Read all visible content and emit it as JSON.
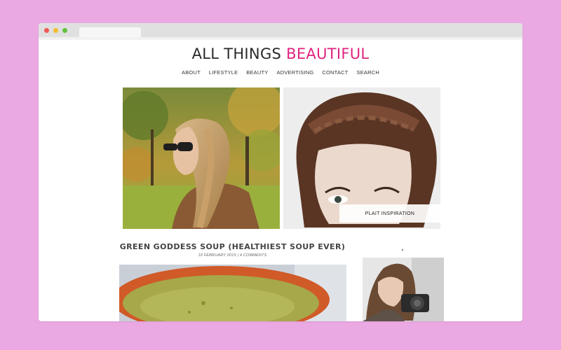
{
  "site": {
    "title_main": "ALL THINGS ",
    "title_accent": "BEAUTIFUL",
    "accent_color": "#e0237f"
  },
  "nav": {
    "items": [
      "ABOUT",
      "LIFESTYLE",
      "BEAUTY",
      "ADVERTISING",
      "CONTACT",
      "SEARCH"
    ]
  },
  "hero": {
    "left_image": "woman-braid-sunglasses-photo",
    "right_image": "woman-crown-braid-photo",
    "caption": "PLAIT INSPIRATION"
  },
  "post": {
    "title": "GREEN GODDESS SOUP (HEALTHIEST SOUP EVER)",
    "meta": "10 FEBRUARY 2015  |  4 COMMENTS",
    "image": "green-soup-bowl-photo"
  },
  "sidebar": {
    "image": "woman-camera-photo"
  },
  "colors": {
    "background": "#eba9e3",
    "window": "#ffffff",
    "chrome": "#e0e0e0"
  }
}
